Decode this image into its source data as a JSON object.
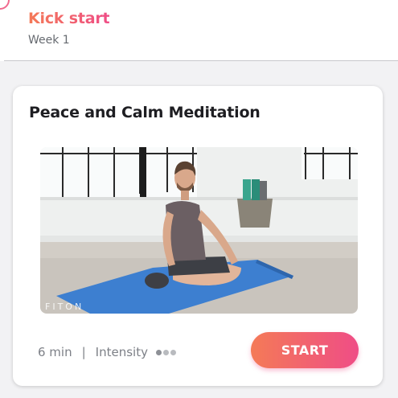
{
  "header": {
    "title": "Kick start",
    "subtitle": "Week 1"
  },
  "workout_card": {
    "title": "Peace and Calm Meditation",
    "video_watermark": "FITON",
    "duration": "6 min",
    "separator": "|",
    "intensity_label": "Intensity",
    "intensity_level": 1,
    "intensity_max": 3,
    "start_label": "START"
  },
  "colors": {
    "accent_start": "#f47a57",
    "accent_end": "#ef4d86",
    "mat": "#3d7fd0"
  }
}
